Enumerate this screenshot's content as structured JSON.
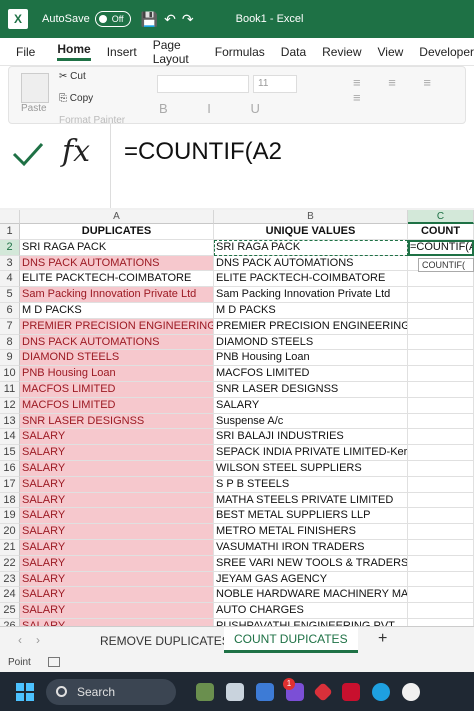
{
  "titlebar": {
    "autosave_label": "AutoSave",
    "toggle_state": "Off",
    "document": "Book1  -  Excel"
  },
  "menu": [
    "File",
    "Home",
    "Insert",
    "Page Layout",
    "Formulas",
    "Data",
    "Review",
    "View",
    "Developer"
  ],
  "ribbon": {
    "paste": "Paste",
    "cut": "Cut",
    "copy": "Copy",
    "format_painter": "Format Painter",
    "font_size": "11",
    "font_style_buttons": "B I U",
    "alignment_buttons": "≡ ≡ ≡ ≡"
  },
  "formula_bar": {
    "fx": "fx",
    "formula": "=COUNTIF(A2"
  },
  "columns": {
    "A": "A",
    "B": "B",
    "C": "C"
  },
  "header_row": {
    "num": "1",
    "a": "DUPLICATES",
    "b": "UNIQUE VALUES",
    "c": "COUNT"
  },
  "rows": [
    {
      "num": "2",
      "a": "SRI RAGA PACK",
      "b": "SRI RAGA PACK",
      "c": "=COUNTIF(A2",
      "dup": false
    },
    {
      "num": "3",
      "a": "DNS PACK AUTOMATIONS",
      "b": "DNS PACK AUTOMATIONS",
      "c": "",
      "dup": true
    },
    {
      "num": "4",
      "a": "ELITE PACKTECH-COIMBATORE",
      "b": "ELITE PACKTECH-COIMBATORE",
      "c": "",
      "dup": false
    },
    {
      "num": "5",
      "a": "Sam Packing Innovation Private Ltd",
      "b": "Sam Packing Innovation Private Ltd",
      "c": "",
      "dup": true
    },
    {
      "num": "6",
      "a": "M D PACKS",
      "b": "M D PACKS",
      "c": "",
      "dup": false
    },
    {
      "num": "7",
      "a": "PREMIER PRECISION ENGINEERING",
      "b": "PREMIER PRECISION ENGINEERING",
      "c": "",
      "dup": true
    },
    {
      "num": "8",
      "a": "DNS PACK AUTOMATIONS",
      "b": "DIAMOND STEELS",
      "c": "",
      "dup": true
    },
    {
      "num": "9",
      "a": "DIAMOND STEELS",
      "b": "PNB Housing Loan",
      "c": "",
      "dup": true
    },
    {
      "num": "10",
      "a": "PNB Housing Loan",
      "b": "MACFOS LIMITED",
      "c": "",
      "dup": true
    },
    {
      "num": "11",
      "a": "MACFOS LIMITED",
      "b": "SNR LASER DESIGNSS",
      "c": "",
      "dup": true
    },
    {
      "num": "12",
      "a": "MACFOS LIMITED",
      "b": "SALARY",
      "c": "",
      "dup": true
    },
    {
      "num": "13",
      "a": "SNR LASER DESIGNSS",
      "b": "Suspense A/c",
      "c": "",
      "dup": true
    },
    {
      "num": "14",
      "a": "SALARY",
      "b": "SRI BALAJI INDUSTRIES",
      "c": "",
      "dup": true
    },
    {
      "num": "15",
      "a": "SALARY",
      "b": "SEPACK INDIA PRIVATE LIMITED-Kerala",
      "c": "",
      "dup": true
    },
    {
      "num": "16",
      "a": "SALARY",
      "b": "WILSON STEEL SUPPLIERS",
      "c": "",
      "dup": true
    },
    {
      "num": "17",
      "a": "SALARY",
      "b": "S P B  STEELS",
      "c": "",
      "dup": true
    },
    {
      "num": "18",
      "a": "SALARY",
      "b": "MATHA STEELS PRIVATE LIMITED",
      "c": "",
      "dup": true
    },
    {
      "num": "19",
      "a": "SALARY",
      "b": "BEST METAL SUPPLIERS LLP",
      "c": "",
      "dup": true
    },
    {
      "num": "20",
      "a": "SALARY",
      "b": "METRO METAL FINISHERS",
      "c": "",
      "dup": true
    },
    {
      "num": "21",
      "a": "SALARY",
      "b": "VASUMATHI IRON TRADERS",
      "c": "",
      "dup": true
    },
    {
      "num": "22",
      "a": "SALARY",
      "b": "SREE VARI NEW TOOLS & TRADERS",
      "c": "",
      "dup": true
    },
    {
      "num": "23",
      "a": "SALARY",
      "b": "JEYAM GAS AGENCY",
      "c": "",
      "dup": true
    },
    {
      "num": "24",
      "a": "SALARY",
      "b": "NOBLE HARDWARE MACHINERY MART",
      "c": "",
      "dup": true
    },
    {
      "num": "25",
      "a": "SALARY",
      "b": "AUTO CHARGES",
      "c": "",
      "dup": true
    },
    {
      "num": "26",
      "a": "SALARY",
      "b": "PUSHPAVATHI ENGINEERING PVT",
      "c": "",
      "dup": true
    }
  ],
  "tooltip": "COUNTIF(",
  "sheet_tabs": {
    "tab1": "REMOVE DUPLICATES",
    "tab2": "COUNT DUPICATES",
    "add": "+"
  },
  "status": {
    "mode": "Point"
  },
  "taskbar": {
    "search": "Search",
    "badge": "1"
  },
  "colors": {
    "excel_green": "#1e7145",
    "duplicate_fill": "#f6c8cd",
    "duplicate_text": "#9c1a23"
  }
}
